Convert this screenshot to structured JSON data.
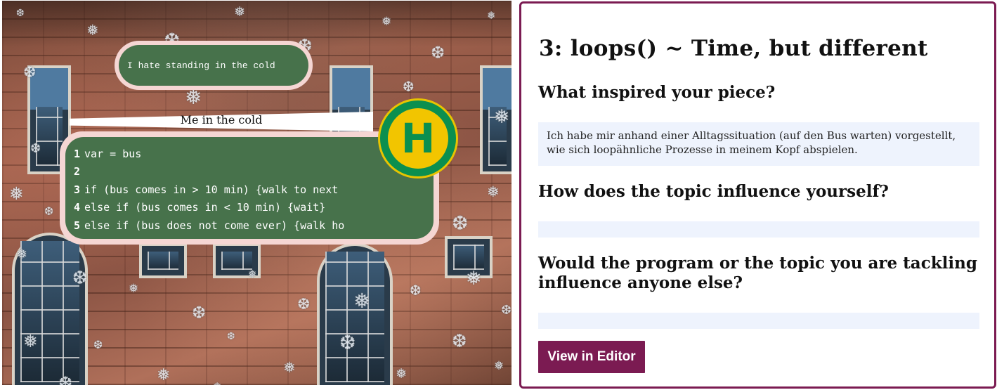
{
  "sketch": {
    "thought_bubble": "I hate standing in the cold",
    "caption": "Me in the cold",
    "code_lines": [
      {
        "num": "1",
        "text": "var = bus"
      },
      {
        "num": "2",
        "text": ""
      },
      {
        "num": "3",
        "text": "if (bus comes in > 10 min) {walk to next"
      },
      {
        "num": "4",
        "text": "else if (bus comes in < 10 min) {wait}"
      },
      {
        "num": "5",
        "text": "else if (bus does not come ever) {walk ho"
      }
    ],
    "bus_stop_letter": "H",
    "colors": {
      "code_bg": "#47724b",
      "bubble_border": "#f5d6d3",
      "stop_green": "#0b8f4f",
      "stop_yellow": "#f2c500"
    }
  },
  "panel": {
    "title": "3: loops() ~ Time, but different",
    "q1": "What inspired your piece?",
    "a1": "Ich habe mir anhand einer Alltagssituation (auf den Bus warten) vorgestellt, wie sich loopähnliche Prozesse in meinem Kopf abspielen.",
    "q2": "How does the topic influence yourself?",
    "a2": "",
    "q3": "Would the program or the topic you are tackling influence anyone else?",
    "a3": "",
    "editor_button": "View in Editor",
    "colors": {
      "accent": "#7b1b52",
      "answer_bg": "#eef3fd"
    }
  }
}
